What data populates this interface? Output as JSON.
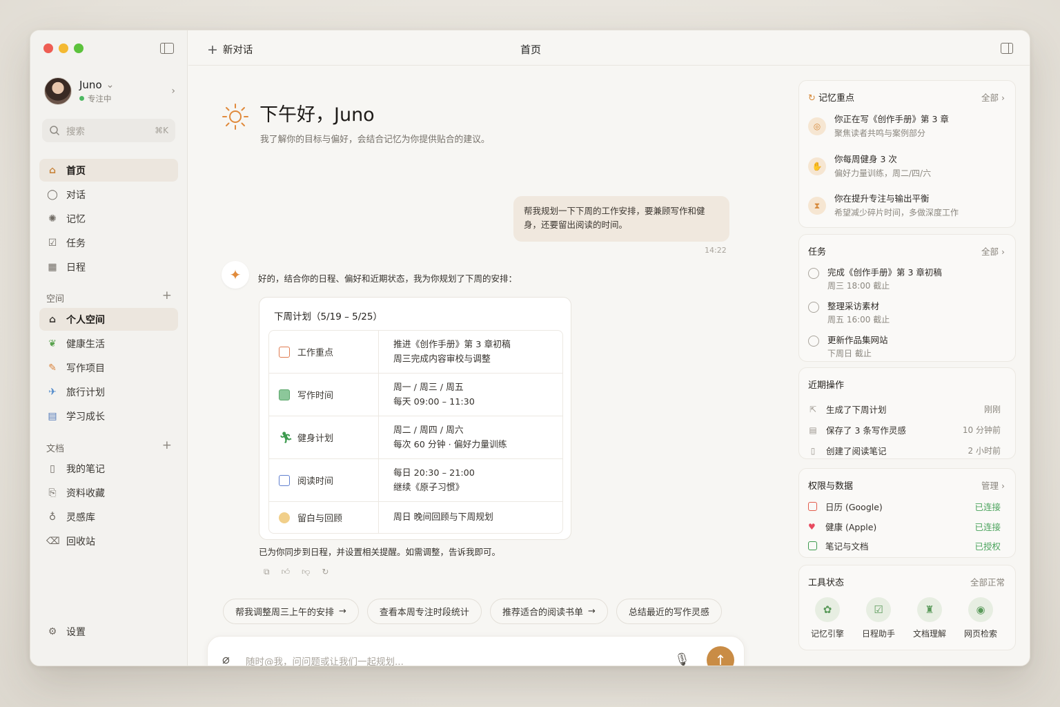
{
  "sidebar": {
    "profile": {
      "name": "Juno",
      "status": "专注中"
    },
    "search": {
      "placeholder": "搜索",
      "shortcut": "⌘K"
    },
    "nav": [
      {
        "label": "首页",
        "icon": "home-icon"
      },
      {
        "label": "对话",
        "icon": "chat-icon"
      },
      {
        "label": "记忆",
        "icon": "memory-icon"
      },
      {
        "label": "任务",
        "icon": "task-icon"
      },
      {
        "label": "日程",
        "icon": "calendar-icon"
      }
    ],
    "spaces_title": "空间",
    "spaces": [
      {
        "label": "个人空间",
        "icon": "home-icon"
      },
      {
        "label": "健康生活",
        "icon": "leaf-icon"
      },
      {
        "label": "写作项目",
        "icon": "pencil-icon"
      },
      {
        "label": "旅行计划",
        "icon": "airplane-icon"
      },
      {
        "label": "学习成长",
        "icon": "book-icon"
      }
    ],
    "docs_title": "文档",
    "docs": [
      {
        "label": "我的笔记",
        "icon": "document-icon"
      },
      {
        "label": "资料收藏",
        "icon": "bookmark-icon"
      },
      {
        "label": "灵感库",
        "icon": "lightbulb-icon"
      },
      {
        "label": "回收站",
        "icon": "trash-icon"
      }
    ],
    "settings_label": "设置"
  },
  "topbar": {
    "new_chat": "新对话",
    "title": "首页"
  },
  "main": {
    "greeting": "下午好，Juno",
    "subtitle": "我了解你的目标与偏好，会结合记忆为你提供贴合的建议。",
    "user_message": "帮我规划一下下周的工作安排，要兼顾写作和健身，还要留出阅读的时间。",
    "user_time": "14:22",
    "ai_intro": "好的，结合你的日程、偏好和近期状态，我为你规划了下周的安排：",
    "plan": {
      "title": "下周计划（5/19 – 5/25）",
      "rows": [
        {
          "label": "工作重点",
          "line1": "推进《创作手册》第 3 章初稿",
          "line2": "周三完成内容审校与调整",
          "color": "#e07b4f"
        },
        {
          "label": "写作时间",
          "line1": "周一 / 周三 / 周五",
          "line2": "每天 09:00 – 11:30",
          "color": "#5aa66a"
        },
        {
          "label": "健身计划",
          "line1": "周二 / 周四 / 周六",
          "line2": "每次 60 分钟 · 偏好力量训练",
          "color": "#3c9a4e"
        },
        {
          "label": "阅读时间",
          "line1": "每日 20:30 – 21:00",
          "line2": "继续《原子习惯》",
          "color": "#5f7fcf"
        },
        {
          "label": "留白与回顾",
          "line1": "周日 晚间回顾与下周规划",
          "line2": "",
          "color": "#e5a23d"
        }
      ]
    },
    "ai_footer": "已为你同步到日程，并设置相关提醒。如需调整，告诉我即可。",
    "chips": [
      {
        "label": "帮我调整周三上午的安排",
        "arrow": "→"
      },
      {
        "label": "查看本周专注时段统计",
        "arrow": ""
      },
      {
        "label": "推荐适合的阅读书单",
        "arrow": "→"
      },
      {
        "label": "总结最近的写作灵感",
        "arrow": ""
      }
    ],
    "composer_placeholder": "随时@我，问问题或让我们一起规划..."
  },
  "right": {
    "memory": {
      "title": "记忆重点",
      "more": "全部",
      "items": [
        {
          "title": "你正在写《创作手册》第 3 章",
          "sub": "聚焦读者共鸣与案例部分"
        },
        {
          "title": "你每周健身 3 次",
          "sub": "偏好力量训练，周二/四/六"
        },
        {
          "title": "你在提升专注与输出平衡",
          "sub": "希望减少碎片时间，多做深度工作"
        }
      ]
    },
    "tasks": {
      "title": "任务",
      "more": "全部",
      "items": [
        {
          "title": "完成《创作手册》第 3 章初稿",
          "due": "周三 18:00 截止"
        },
        {
          "title": "整理采访素材",
          "due": "周五 16:00 截止"
        },
        {
          "title": "更新作品集网站",
          "due": "下周日 截止"
        }
      ]
    },
    "recent": {
      "title": "近期操作",
      "items": [
        {
          "label": "生成了下周计划",
          "time": "刚刚"
        },
        {
          "label": "保存了 3 条写作灵感",
          "time": "10 分钟前"
        },
        {
          "label": "创建了阅读笔记",
          "time": "2 小时前"
        }
      ]
    },
    "permissions": {
      "title": "权限与数据",
      "more": "管理",
      "items": [
        {
          "label": "日历 (Google)",
          "state": "已连接",
          "color": "#e35b4b"
        },
        {
          "label": "健康 (Apple)",
          "state": "已连接",
          "color": "#e84a5f"
        },
        {
          "label": "笔记与文档",
          "state": "已授权",
          "color": "#3c9a4e"
        }
      ]
    },
    "tools": {
      "title": "工具状态",
      "status": "全部正常",
      "items": [
        {
          "label": "记忆引擎",
          "icon": "brain-icon"
        },
        {
          "label": "日程助手",
          "icon": "calendar-check-icon"
        },
        {
          "label": "文档理解",
          "icon": "stamp-icon"
        },
        {
          "label": "网页检索",
          "icon": "search-icon"
        }
      ]
    }
  }
}
